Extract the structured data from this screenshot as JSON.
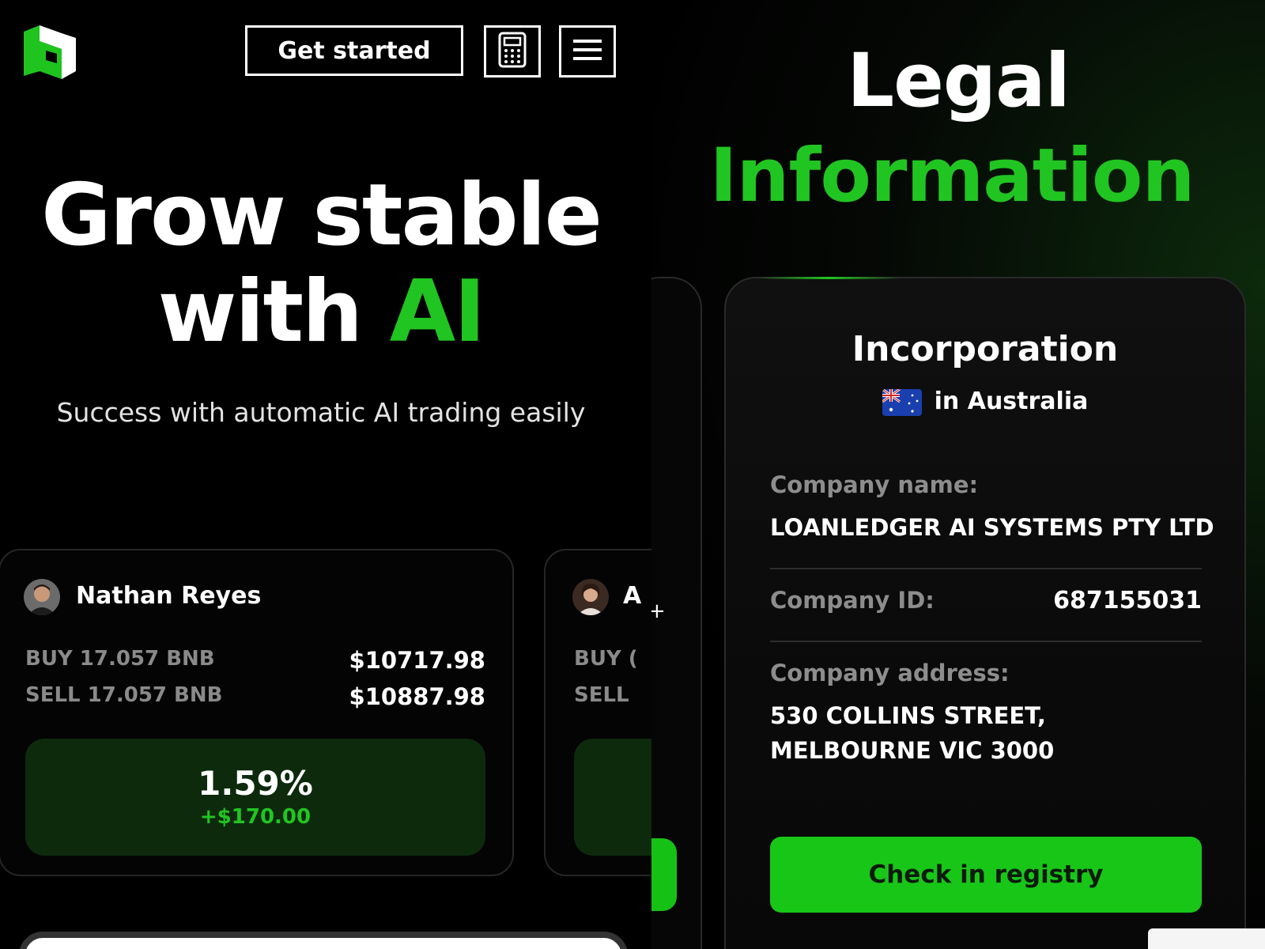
{
  "left": {
    "header": {
      "logo_icon": "brand-logo-icon",
      "get_started_label": "Get started",
      "calculator_icon": "calculator-icon",
      "menu_icon": "hamburger-menu-icon"
    },
    "hero": {
      "title_line1": "Grow stable",
      "title_line2_prefix": "with ",
      "title_line2_accent": "AI",
      "subtitle": "Success with automatic AI trading easily"
    },
    "trade_cards": [
      {
        "name": "Nathan Reyes",
        "buy_label": "BUY 17.057 BNB",
        "buy_price": "$10717.98",
        "sell_label": "SELL 17.057 BNB",
        "sell_price": "$10887.98",
        "profit_pct": "1.59%",
        "profit_usd": "+$170.00"
      },
      {
        "name_partial": "A",
        "buy_label_partial": "BUY (",
        "sell_label_partial": "SELL"
      }
    ]
  },
  "right": {
    "heading_line1": "Legal",
    "heading_line2": "Information",
    "ghost_char": "+",
    "incorporation": {
      "title": "Incorporation",
      "country": "in Australia",
      "flag_icon": "australia-flag-icon",
      "company_name_label": "Company name:",
      "company_name_value": "LOANLEDGER AI SYSTEMS PTY LTD",
      "company_id_label": "Company ID:",
      "company_id_value": "687155031",
      "company_address_label": "Company address:",
      "company_address_line1": "530 COLLINS STREET,",
      "company_address_line2": "MELBOURNE VIC 3000",
      "registry_button_label": "Check in registry"
    }
  },
  "colors": {
    "accent_green": "#21c521",
    "button_green": "#18c618",
    "profit_bg": "#0d2a0d",
    "background": "#000000"
  }
}
